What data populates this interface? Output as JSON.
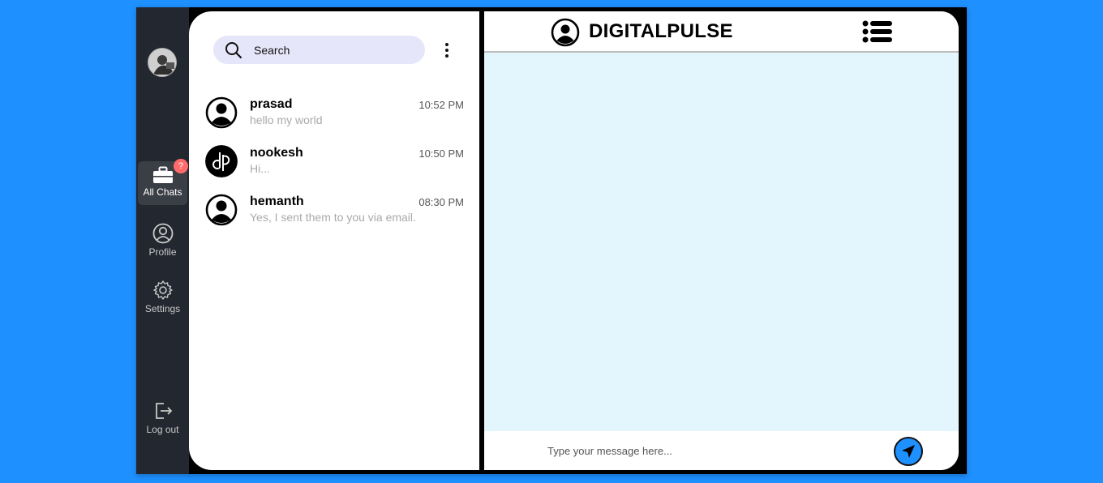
{
  "sidebar": {
    "items": [
      {
        "label": "All Chats",
        "icon": "briefcase-icon",
        "badge": "?",
        "active": true
      },
      {
        "label": "Profile",
        "icon": "user-circle-icon"
      },
      {
        "label": "Settings",
        "icon": "gear-icon"
      }
    ],
    "logout_label": "Log out"
  },
  "search": {
    "placeholder": "Search"
  },
  "chats": [
    {
      "name": "prasad",
      "time": "10:52 PM",
      "preview": "hello my world",
      "avatar": "user-icon"
    },
    {
      "name": "nookesh",
      "time": "10:50 PM",
      "preview": "Hi...",
      "avatar": "dp-logo"
    },
    {
      "name": "hemanth",
      "time": "08:30 PM",
      "preview": "Yes, I sent them to you via email.",
      "avatar": "user-icon"
    }
  ],
  "conversation": {
    "title": "DIGITALPULSE",
    "composer_placeholder": "Type your message here..."
  },
  "colors": {
    "page_bg": "#1e90ff",
    "rail_bg": "#23272f",
    "messages_bg": "#e3f6fd",
    "search_bg": "#e6e6fa",
    "badge": "#ff6b6b",
    "send_button": "#1e90ff"
  }
}
